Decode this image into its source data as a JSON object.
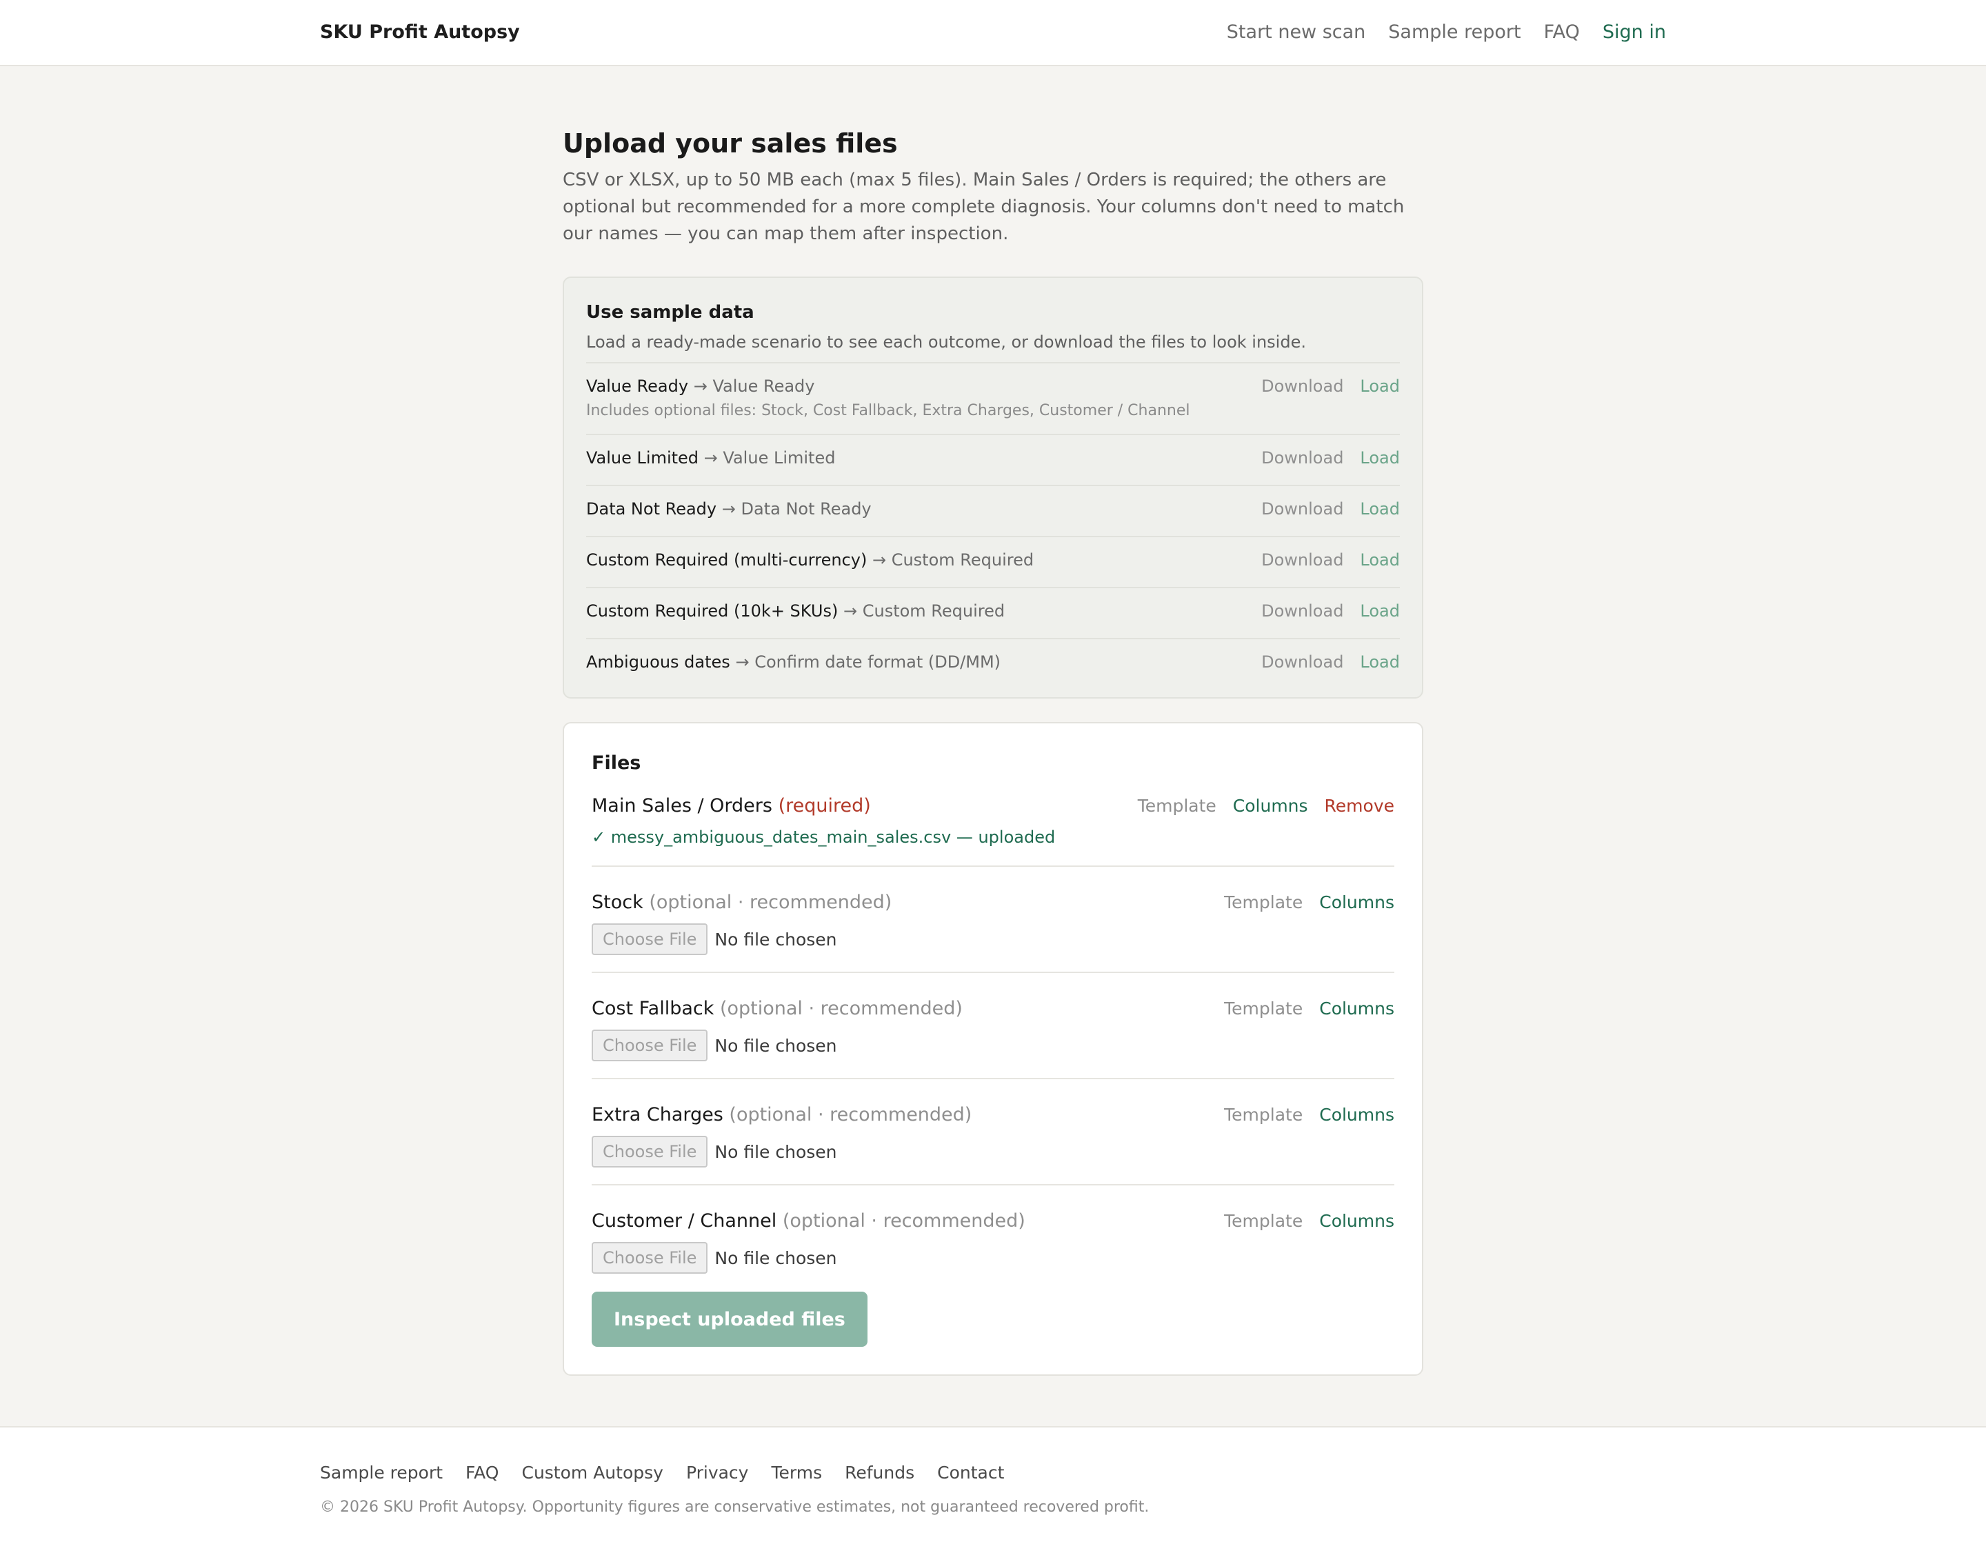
{
  "header": {
    "brand": "SKU Profit Autopsy",
    "nav": [
      "Start new scan",
      "Sample report",
      "FAQ"
    ],
    "signin": "Sign in"
  },
  "page": {
    "title": "Upload your sales files",
    "intro": "CSV or XLSX, up to 50 MB each (max 5 files). Main Sales / Orders is required; the others are optional but recommended for a more complete diagnosis. Your columns don't need to match our names — you can map them after inspection."
  },
  "sample": {
    "title": "Use sample data",
    "description": "Load a ready-made scenario to see each outcome, or download the files to look inside.",
    "download_label": "Download",
    "load_label": "Load",
    "arrow": "→",
    "scenarios": [
      {
        "name": "Value Ready",
        "outcome": "Value Ready",
        "extra": "Includes optional files: Stock, Cost Fallback, Extra Charges, Customer / Channel"
      },
      {
        "name": "Value Limited",
        "outcome": "Value Limited"
      },
      {
        "name": "Data Not Ready",
        "outcome": "Data Not Ready"
      },
      {
        "name": "Custom Required (multi-currency)",
        "outcome": "Custom Required"
      },
      {
        "name": "Custom Required (10k+ SKUs)",
        "outcome": "Custom Required"
      },
      {
        "name": "Ambiguous dates",
        "outcome": "Confirm date format (DD/MM)"
      }
    ]
  },
  "files": {
    "title": "Files",
    "template_label": "Template",
    "columns_label": "Columns",
    "remove_label": "Remove",
    "choose_label": "Choose File",
    "no_file_label": "No file chosen",
    "main": {
      "label": "Main Sales / Orders",
      "tag": "(required)",
      "uploaded": "✓ messy_ambiguous_dates_main_sales.csv — uploaded"
    },
    "optional_tag": "(optional · recommended)",
    "optional": [
      {
        "label": "Stock"
      },
      {
        "label": "Cost Fallback"
      },
      {
        "label": "Extra Charges"
      },
      {
        "label": "Customer / Channel"
      }
    ],
    "inspect_button": "Inspect uploaded files"
  },
  "footer": {
    "links": [
      "Sample report",
      "FAQ",
      "Custom Autopsy",
      "Privacy",
      "Terms",
      "Refunds",
      "Contact"
    ],
    "copyright": "© 2026 SKU Profit Autopsy. Opportunity figures are conservative estimates, not guaranteed recovered profit."
  },
  "colors": {
    "accent": "#1f6b50",
    "required": "#b23a2a",
    "button": "#8ab7a6",
    "background": "#f5f4f1"
  }
}
